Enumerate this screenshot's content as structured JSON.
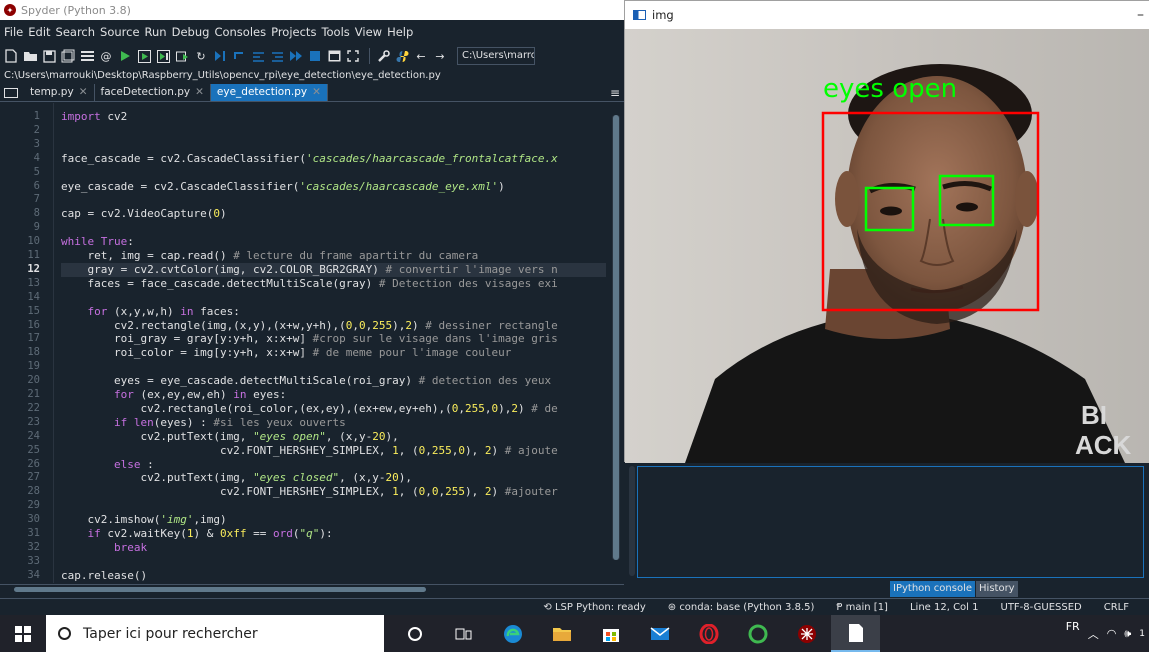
{
  "spyder": {
    "window_title": "Spyder (Python 3.8)",
    "menu": [
      "File",
      "Edit",
      "Search",
      "Source",
      "Run",
      "Debug",
      "Consoles",
      "Projects",
      "Tools",
      "View",
      "Help"
    ],
    "toolbar_path": "C:\\Users\\marro",
    "file_path": "C:\\Users\\marrouki\\Desktop\\Raspberry_Utils\\opencv_rpi\\eye_detection\\eye_detection.py",
    "tabs": [
      {
        "label": "temp.py"
      },
      {
        "label": "faceDetection.py"
      },
      {
        "label": "eye_detection.py"
      }
    ],
    "line_numbers": [
      "1",
      "2",
      "3",
      "4",
      "5",
      "6",
      "7",
      "8",
      "9",
      "10",
      "11",
      "12",
      "13",
      "14",
      "15",
      "16",
      "17",
      "18",
      "19",
      "20",
      "21",
      "22",
      "23",
      "24",
      "25",
      "26",
      "27",
      "28",
      "29",
      "30",
      "31",
      "32",
      "33",
      "34"
    ],
    "current_line": "12"
  },
  "code_lines": [
    [
      {
        "t": "kw",
        "s": "import"
      },
      {
        "t": "fn",
        "s": " cv2"
      }
    ],
    [],
    [],
    [
      {
        "t": "fn",
        "s": "face_cascade = cv2.CascadeClassifier("
      },
      {
        "t": "str",
        "s": "'cascades/haarcascade_frontalcatface.x"
      }
    ],
    [],
    [
      {
        "t": "fn",
        "s": "eye_cascade = cv2.CascadeClassifier("
      },
      {
        "t": "str",
        "s": "'cascades/haarcascade_eye.xml'"
      },
      {
        "t": "fn",
        "s": ")"
      }
    ],
    [],
    [
      {
        "t": "fn",
        "s": "cap = cv2.VideoCapture("
      },
      {
        "t": "num",
        "s": "0"
      },
      {
        "t": "fn",
        "s": ")"
      }
    ],
    [],
    [
      {
        "t": "kw",
        "s": "while"
      },
      {
        "t": "fn",
        "s": " "
      },
      {
        "t": "kw",
        "s": "True"
      },
      {
        "t": "fn",
        "s": ":"
      }
    ],
    [
      {
        "t": "fn",
        "s": "    ret, img = cap.read() "
      },
      {
        "t": "cm",
        "s": "# lecture du frame apartitr du camera"
      }
    ],
    [
      {
        "t": "fn",
        "s": "    gray = cv2.cvtColor(img, cv2.COLOR_BGR2GRAY) "
      },
      {
        "t": "cm",
        "s": "# convertir l'image vers n"
      }
    ],
    [
      {
        "t": "fn",
        "s": "    faces = face_cascade.detectMultiScale(gray) "
      },
      {
        "t": "cm",
        "s": "# Detection des visages exi"
      }
    ],
    [],
    [
      {
        "t": "fn",
        "s": "    "
      },
      {
        "t": "kw",
        "s": "for"
      },
      {
        "t": "fn",
        "s": " (x,y,w,h) "
      },
      {
        "t": "kw",
        "s": "in"
      },
      {
        "t": "fn",
        "s": " faces:"
      }
    ],
    [
      {
        "t": "fn",
        "s": "        cv2.rectangle(img,(x,y),(x+w,y+h),("
      },
      {
        "t": "num",
        "s": "0"
      },
      {
        "t": "fn",
        "s": ","
      },
      {
        "t": "num",
        "s": "0"
      },
      {
        "t": "fn",
        "s": ","
      },
      {
        "t": "num",
        "s": "255"
      },
      {
        "t": "fn",
        "s": "),"
      },
      {
        "t": "num",
        "s": "2"
      },
      {
        "t": "fn",
        "s": ") "
      },
      {
        "t": "cm",
        "s": "# dessiner rectangle"
      }
    ],
    [
      {
        "t": "fn",
        "s": "        roi_gray = gray[y:y+h, x:x+w] "
      },
      {
        "t": "cm",
        "s": "#crop sur le visage dans l'image gris"
      }
    ],
    [
      {
        "t": "fn",
        "s": "        roi_color = img[y:y+h, x:x+w] "
      },
      {
        "t": "cm",
        "s": "# de meme pour l'image couleur"
      }
    ],
    [],
    [
      {
        "t": "fn",
        "s": "        eyes = eye_cascade.detectMultiScale(roi_gray) "
      },
      {
        "t": "cm",
        "s": "# detection des yeux"
      }
    ],
    [
      {
        "t": "fn",
        "s": "        "
      },
      {
        "t": "kw",
        "s": "for"
      },
      {
        "t": "fn",
        "s": " (ex,ey,ew,eh) "
      },
      {
        "t": "kw",
        "s": "in"
      },
      {
        "t": "fn",
        "s": " eyes:"
      }
    ],
    [
      {
        "t": "fn",
        "s": "            cv2.rectangle(roi_color,(ex,ey),(ex+ew,ey+eh),("
      },
      {
        "t": "num",
        "s": "0"
      },
      {
        "t": "fn",
        "s": ","
      },
      {
        "t": "num",
        "s": "255"
      },
      {
        "t": "fn",
        "s": ","
      },
      {
        "t": "num",
        "s": "0"
      },
      {
        "t": "fn",
        "s": "),"
      },
      {
        "t": "num",
        "s": "2"
      },
      {
        "t": "fn",
        "s": ") "
      },
      {
        "t": "cm",
        "s": "# de"
      }
    ],
    [
      {
        "t": "fn",
        "s": "        "
      },
      {
        "t": "kw",
        "s": "if"
      },
      {
        "t": "fn",
        "s": " "
      },
      {
        "t": "kw",
        "s": "len"
      },
      {
        "t": "fn",
        "s": "(eyes) : "
      },
      {
        "t": "cm",
        "s": "#si les yeux ouverts"
      }
    ],
    [
      {
        "t": "fn",
        "s": "            cv2.putText(img, "
      },
      {
        "t": "str",
        "s": "\"eyes open\""
      },
      {
        "t": "fn",
        "s": ", (x,y-"
      },
      {
        "t": "num",
        "s": "20"
      },
      {
        "t": "fn",
        "s": "),"
      }
    ],
    [
      {
        "t": "fn",
        "s": "                        cv2.FONT_HERSHEY_SIMPLEX, "
      },
      {
        "t": "num",
        "s": "1"
      },
      {
        "t": "fn",
        "s": ", ("
      },
      {
        "t": "num",
        "s": "0"
      },
      {
        "t": "fn",
        "s": ","
      },
      {
        "t": "num",
        "s": "255"
      },
      {
        "t": "fn",
        "s": ","
      },
      {
        "t": "num",
        "s": "0"
      },
      {
        "t": "fn",
        "s": "), "
      },
      {
        "t": "num",
        "s": "2"
      },
      {
        "t": "fn",
        "s": ") "
      },
      {
        "t": "cm",
        "s": "# ajoute"
      }
    ],
    [
      {
        "t": "fn",
        "s": "        "
      },
      {
        "t": "kw",
        "s": "else"
      },
      {
        "t": "fn",
        "s": " :"
      }
    ],
    [
      {
        "t": "fn",
        "s": "            cv2.putText(img, "
      },
      {
        "t": "str",
        "s": "\"eyes closed\""
      },
      {
        "t": "fn",
        "s": ", (x,y-"
      },
      {
        "t": "num",
        "s": "20"
      },
      {
        "t": "fn",
        "s": "),"
      }
    ],
    [
      {
        "t": "fn",
        "s": "                        cv2.FONT_HERSHEY_SIMPLEX, "
      },
      {
        "t": "num",
        "s": "1"
      },
      {
        "t": "fn",
        "s": ", ("
      },
      {
        "t": "num",
        "s": "0"
      },
      {
        "t": "fn",
        "s": ","
      },
      {
        "t": "num",
        "s": "0"
      },
      {
        "t": "fn",
        "s": ","
      },
      {
        "t": "num",
        "s": "255"
      },
      {
        "t": "fn",
        "s": "), "
      },
      {
        "t": "num",
        "s": "2"
      },
      {
        "t": "fn",
        "s": ") "
      },
      {
        "t": "cm",
        "s": "#ajouter"
      }
    ],
    [],
    [
      {
        "t": "fn",
        "s": "    cv2.imshow("
      },
      {
        "t": "str",
        "s": "'img'"
      },
      {
        "t": "fn",
        "s": ",img)"
      }
    ],
    [
      {
        "t": "fn",
        "s": "    "
      },
      {
        "t": "kw",
        "s": "if"
      },
      {
        "t": "fn",
        "s": " cv2.waitKey("
      },
      {
        "t": "num",
        "s": "1"
      },
      {
        "t": "fn",
        "s": ") & "
      },
      {
        "t": "num",
        "s": "0xff"
      },
      {
        "t": "fn",
        "s": " == "
      },
      {
        "t": "kw",
        "s": "ord"
      },
      {
        "t": "fn",
        "s": "("
      },
      {
        "t": "str",
        "s": "\"q\""
      },
      {
        "t": "fn",
        "s": "):"
      }
    ],
    [
      {
        "t": "fn",
        "s": "        "
      },
      {
        "t": "kw",
        "s": "break"
      }
    ],
    [],
    [
      {
        "t": "fn",
        "s": "cap.release()"
      }
    ]
  ],
  "console": {
    "tabs": [
      "IPython console",
      "History"
    ]
  },
  "statusbar": {
    "lsp": "LSP Python: ready",
    "conda": "conda: base (Python 3.8.5)",
    "git": "main [1]",
    "cursor": "Line 12, Col 1",
    "encoding": "UTF-8-GUESSED",
    "eol": "CRLF"
  },
  "image_window": {
    "title": "img",
    "overlay_text": "eyes open",
    "overlay_color": "#00ff00",
    "face_box_color": "#ff0000",
    "eye_box_color": "#00ff00",
    "shirt_text": "BI\nACK"
  },
  "taskbar": {
    "search_placeholder": "Taper ici pour rechercher",
    "language": "FR"
  },
  "colors": {
    "bg": "#19232d",
    "accent": "#1a72bb",
    "keyword": "#c670e0",
    "string": "#b0e686",
    "number": "#faed5c",
    "comment": "#999999"
  }
}
